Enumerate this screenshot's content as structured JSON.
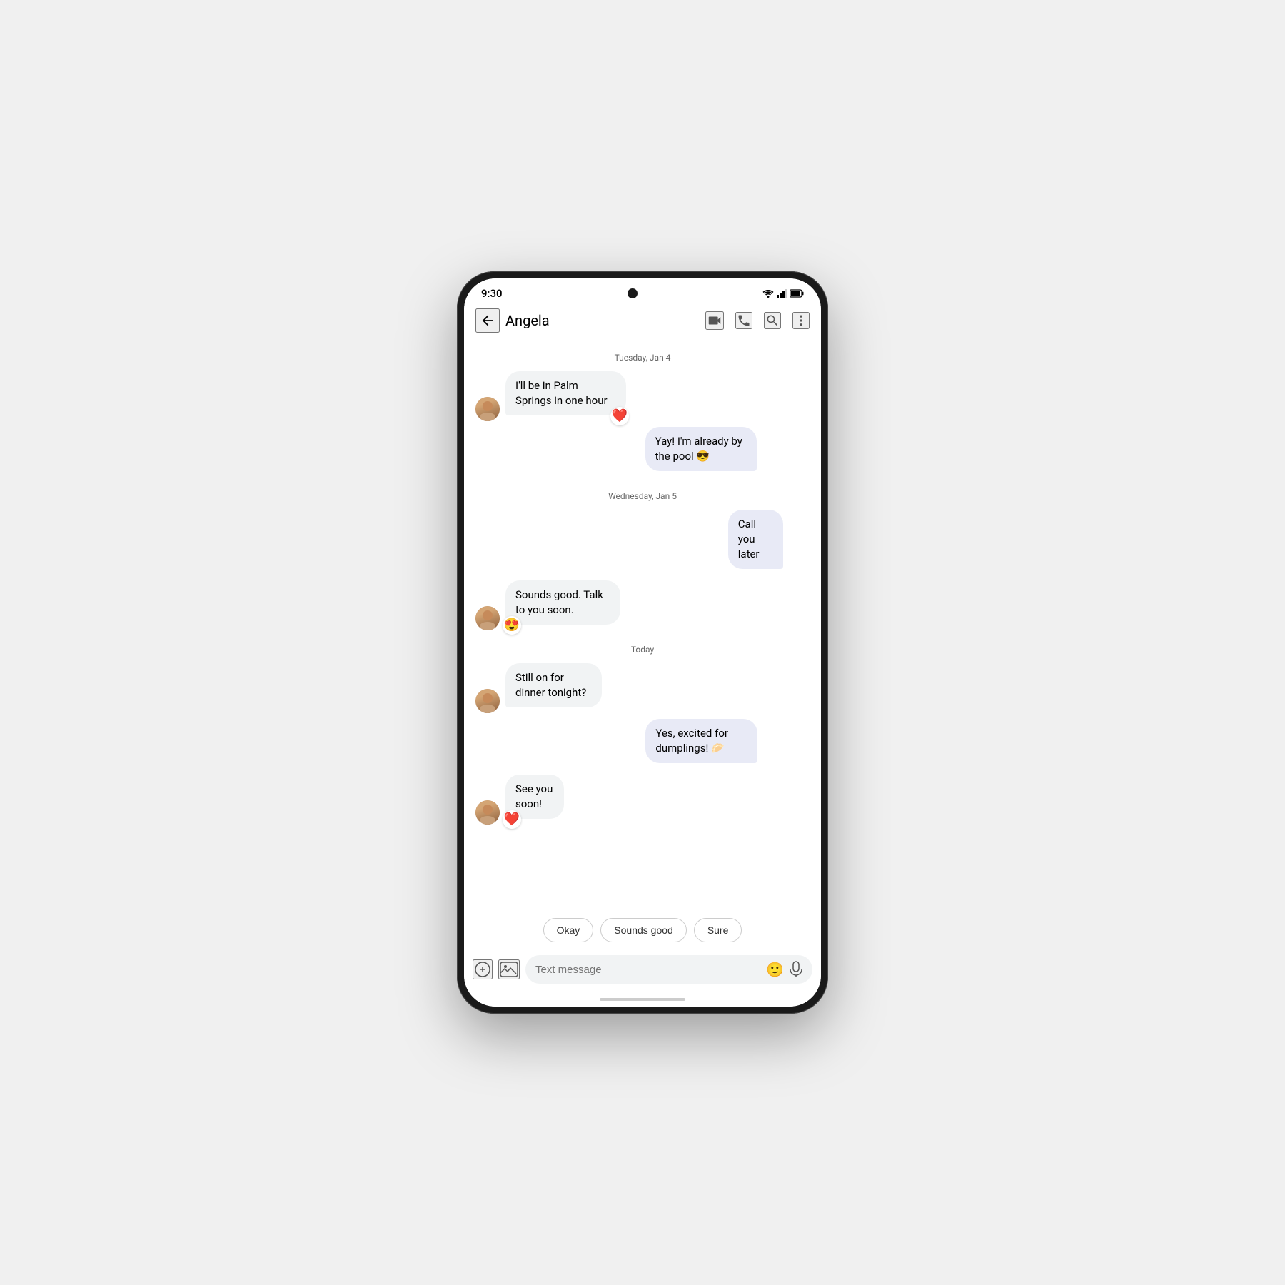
{
  "statusBar": {
    "time": "9:30"
  },
  "appBar": {
    "contactName": "Angela",
    "backLabel": "←"
  },
  "messages": [
    {
      "id": "msg1",
      "type": "date",
      "text": "Tuesday, Jan 4"
    },
    {
      "id": "msg2",
      "type": "incoming",
      "text": "I'll be in Palm Springs in one hour",
      "reaction": "❤️"
    },
    {
      "id": "msg3",
      "type": "outgoing",
      "text": "Yay! I'm already by the pool 😎"
    },
    {
      "id": "msg4",
      "type": "date",
      "text": "Wednesday, Jan 5"
    },
    {
      "id": "msg5",
      "type": "outgoing",
      "text": "Call you later"
    },
    {
      "id": "msg6",
      "type": "incoming",
      "text": "Sounds good. Talk to you soon.",
      "reaction": "😍"
    },
    {
      "id": "msg7",
      "type": "date",
      "text": "Today"
    },
    {
      "id": "msg8",
      "type": "incoming",
      "text": "Still on for dinner tonight?"
    },
    {
      "id": "msg9",
      "type": "outgoing",
      "text": "Yes, excited for dumplings! 🥟"
    },
    {
      "id": "msg10",
      "type": "incoming",
      "text": "See you soon!",
      "reaction": "❤️"
    }
  ],
  "smartReplies": [
    {
      "id": "sr1",
      "label": "Okay"
    },
    {
      "id": "sr2",
      "label": "Sounds good"
    },
    {
      "id": "sr3",
      "label": "Sure"
    }
  ],
  "inputBar": {
    "placeholder": "Text message"
  }
}
